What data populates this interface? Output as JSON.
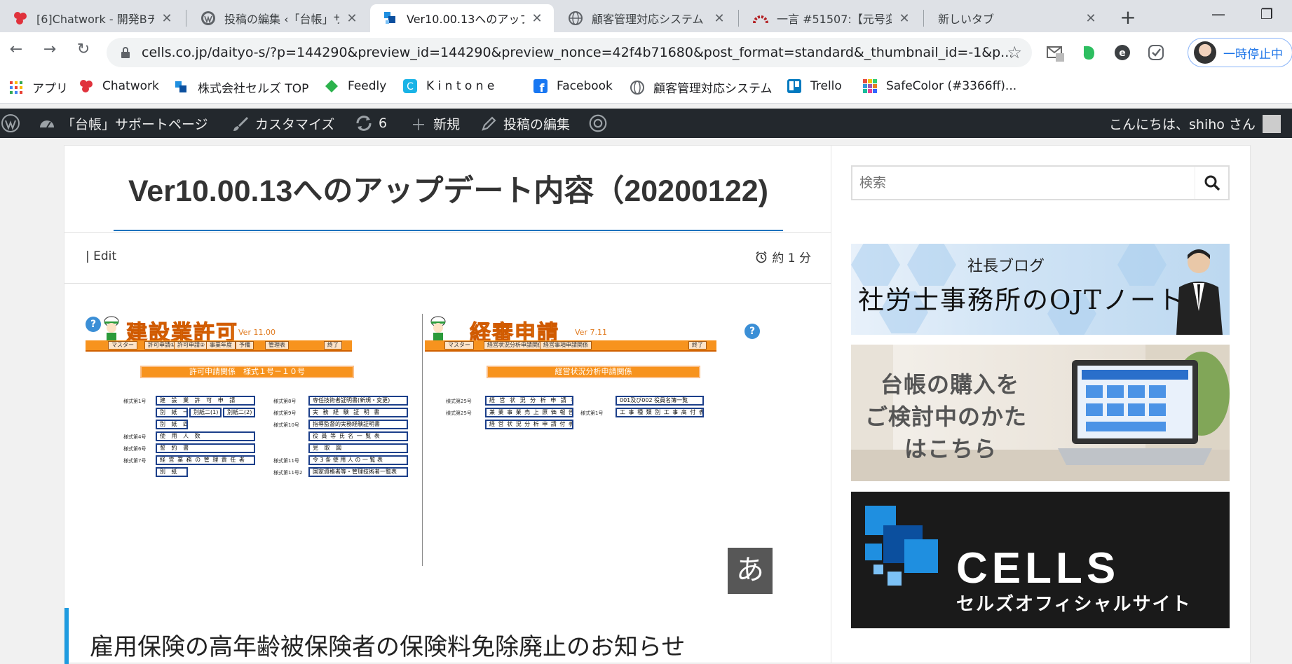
{
  "browser": {
    "tabs": [
      {
        "title": "[6]Chatwork - 開発Bチ",
        "icon": "chatwork-icon"
      },
      {
        "title": "投稿の編集 ‹「台帳」サ",
        "icon": "wordpress-icon"
      },
      {
        "title": "Ver10.00.13へのアップデ",
        "icon": "cells-icon",
        "active": true
      },
      {
        "title": "顧客管理対応システム",
        "icon": "globe-icon"
      },
      {
        "title": "一言 #51507:【元号変",
        "icon": "redmine-icon"
      },
      {
        "title": "新しいタブ",
        "icon": ""
      }
    ],
    "new_tab": "+",
    "window_controls": {
      "minimize": "—",
      "maximize": "❐"
    },
    "url": "cells.co.jp/daityo-s/?p=144290&preview_id=144290&preview_nonce=42f4b71680&post_format=standard&_thumbnail_id=-1&p...",
    "profile_label": "一時停止中",
    "bookmarks": [
      {
        "label": "アプリ",
        "icon": "apps-grid-icon"
      },
      {
        "label": "Chatwork",
        "icon": "chatwork-icon"
      },
      {
        "label": "株式会社セルズ TOP",
        "icon": "cells-icon"
      },
      {
        "label": "Feedly",
        "icon": "feedly-icon"
      },
      {
        "label": "K i n t o n e",
        "icon": "kintone-icon"
      },
      {
        "label": "Facebook",
        "icon": "facebook-icon"
      },
      {
        "label": "顧客管理対応システム",
        "icon": "globe-icon"
      },
      {
        "label": "Trello",
        "icon": "trello-icon"
      },
      {
        "label": "SafeColor (#3366ff)...",
        "icon": "safecolor-icon"
      }
    ]
  },
  "adminbar": {
    "site_name": "「台帳」サポートページ",
    "customize": "カスタマイズ",
    "updates": "6",
    "new": "新規",
    "edit_post": "投稿の編集",
    "greeting": "こんにちは、shiho さん"
  },
  "post": {
    "title": "Ver10.00.13へのアップデート内容（20200122)",
    "edit_link": "| Edit",
    "read_time": "約 1 分",
    "next_heading": "雇用保険の高年齢被保険者の保険料免除廃止のお知らせ",
    "ime_indicator": "あ"
  },
  "screenshot_img": {
    "left": {
      "title": "建設業許可",
      "version": "Ver 11.00",
      "menu": [
        "マスター",
        "許可申請①",
        "許可申請②",
        "事業年度",
        "予備",
        "管理表",
        "終了"
      ],
      "banner": "許可申請関係　様式１号－１０号",
      "rows_left": [
        {
          "label": "様式第1号",
          "boxes": [
            "建 設 業 許 可 申 請"
          ]
        },
        {
          "label": "",
          "boxes": [
            "別 紙 一",
            "別紙二(1)",
            "別紙二(2)"
          ]
        },
        {
          "label": "",
          "boxes": [
            "別 紙 四"
          ]
        },
        {
          "label": "様式第4号",
          "boxes": [
            "使 用 人 数"
          ]
        },
        {
          "label": "様式第6号",
          "boxes": [
            "誓 約 書"
          ]
        },
        {
          "label": "様式第7号",
          "boxes": [
            "経 営 業 務 の 管 理 責 任 者"
          ]
        },
        {
          "label": "",
          "boxes": [
            "別 紙"
          ]
        }
      ],
      "rows_right": [
        {
          "label": "様式第8号",
          "box": "専任技術者証明書(新規・変更)"
        },
        {
          "label": "様式第9号",
          "box": "実 務 経 験 証 明 書"
        },
        {
          "label": "様式第10号",
          "box": "指導監督的実務経験証明書"
        },
        {
          "label": "",
          "box": "役 員 等 氏 名 一 覧 表"
        },
        {
          "label": "",
          "box": "見 取 図"
        },
        {
          "label": "様式第11号",
          "box": "令 3 条 使 用 人 の 一 覧 表"
        },
        {
          "label": "様式第11号2",
          "box": "国家資格者等・管理技術者一覧表"
        }
      ]
    },
    "right": {
      "title": "経審申請",
      "version": "Ver 7.11",
      "menu": [
        "マスター",
        "経営状況分析申請関係",
        "経営事項申請関係",
        "終了"
      ],
      "banner": "経営状況分析申請関係",
      "rows": [
        {
          "label": "様式第25号",
          "box": "経 営 状 況 分 析 申 請 書"
        },
        {
          "label": "様式第25号",
          "box": "兼 業 事 業 売 上 原 価 報 告 書"
        },
        {
          "label": "",
          "box": "経 営 状 況 分 析 申 請 付 表"
        }
      ],
      "rows_right": [
        {
          "label": "",
          "box": "001及び002 役員名簿一覧"
        },
        {
          "label": "様式第1号",
          "box": "工 事 種 類 別 工 事 高 付 表"
        }
      ]
    }
  },
  "sidebar": {
    "search_placeholder": "検索",
    "banner_blog_sub": "社長ブログ",
    "banner_blog_title": "社労士事務所のOJTノート",
    "banner_buy_lines": [
      "台帳の購入を",
      "ご検討中のかた",
      "はこちら"
    ],
    "banner_cells_word": "CELLS",
    "banner_cells_sub": "セルズオフィシャルサイト"
  },
  "colors": {
    "accent_blue": "#1e73be",
    "wp_admin_bar": "#23282d",
    "app_orange": "#f7931e",
    "cells_blue": "#1f8fe0"
  }
}
